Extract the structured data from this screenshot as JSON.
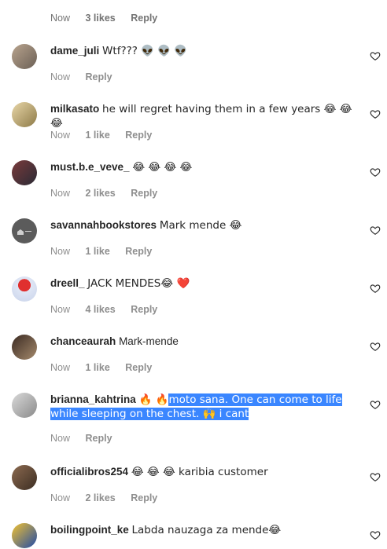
{
  "top_meta": {
    "time": "Now",
    "likes": "3 likes",
    "reply": "Reply"
  },
  "comments": [
    {
      "user": "dame_juli",
      "text": "Wtf??? 👽 👽 👽",
      "time": "Now",
      "likes": "",
      "reply": "Reply"
    },
    {
      "user": "milkasato",
      "text": "he will regret having them in a few years 😂 😂 😂",
      "time": "Now",
      "likes": "1 like",
      "reply": "Reply"
    },
    {
      "user": "must.b.e_veve_",
      "text": "😂 😂 😂 😂",
      "time": "Now",
      "likes": "2 likes",
      "reply": "Reply"
    },
    {
      "user": "savannahbookstores",
      "text": "Mark mende 😂",
      "time": "Now",
      "likes": "1 like",
      "reply": "Reply"
    },
    {
      "user": "dreell_",
      "text": "JACK MENDES😂 ❤️",
      "time": "Now",
      "likes": "4 likes",
      "reply": "Reply"
    },
    {
      "user": "chanceaurah",
      "text": "Mark-mende",
      "time": "Now",
      "likes": "1 like",
      "reply": "Reply"
    },
    {
      "user": "brianna_kahtrina",
      "text_prefix": "🔥 🔥",
      "text_highlight": "moto sana. One can come to life while sleeping on the chest. 🙌 i cant",
      "time": "Now",
      "likes": "",
      "reply": "Reply"
    },
    {
      "user": "officialibros254",
      "text": "😂 😂 😂 karibia customer",
      "time": "Now",
      "likes": "2 likes",
      "reply": "Reply"
    },
    {
      "user": "boilingpoint_ke",
      "text": "Labda nauzaga za mende😂",
      "time": "",
      "likes": "",
      "reply": ""
    }
  ],
  "icons": {
    "like": "heart-outline-icon"
  },
  "colors": {
    "highlight": "#3a86ff",
    "meta": "#8e8e8e",
    "text": "#262626"
  }
}
